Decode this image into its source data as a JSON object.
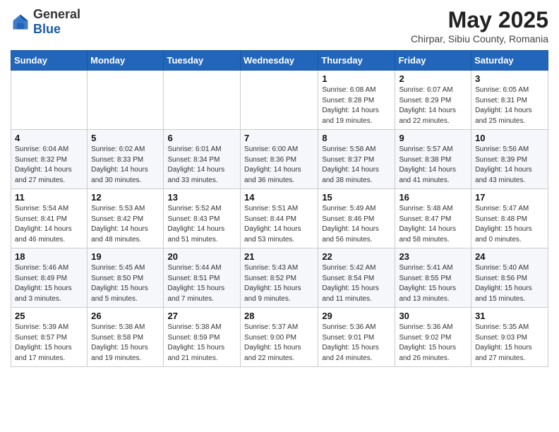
{
  "header": {
    "logo_general": "General",
    "logo_blue": "Blue",
    "month_title": "May 2025",
    "subtitle": "Chirpar, Sibiu County, Romania"
  },
  "weekdays": [
    "Sunday",
    "Monday",
    "Tuesday",
    "Wednesday",
    "Thursday",
    "Friday",
    "Saturday"
  ],
  "weeks": [
    [
      {
        "day": "",
        "info": ""
      },
      {
        "day": "",
        "info": ""
      },
      {
        "day": "",
        "info": ""
      },
      {
        "day": "",
        "info": ""
      },
      {
        "day": "1",
        "info": "Sunrise: 6:08 AM\nSunset: 8:28 PM\nDaylight: 14 hours\nand 19 minutes."
      },
      {
        "day": "2",
        "info": "Sunrise: 6:07 AM\nSunset: 8:29 PM\nDaylight: 14 hours\nand 22 minutes."
      },
      {
        "day": "3",
        "info": "Sunrise: 6:05 AM\nSunset: 8:31 PM\nDaylight: 14 hours\nand 25 minutes."
      }
    ],
    [
      {
        "day": "4",
        "info": "Sunrise: 6:04 AM\nSunset: 8:32 PM\nDaylight: 14 hours\nand 27 minutes."
      },
      {
        "day": "5",
        "info": "Sunrise: 6:02 AM\nSunset: 8:33 PM\nDaylight: 14 hours\nand 30 minutes."
      },
      {
        "day": "6",
        "info": "Sunrise: 6:01 AM\nSunset: 8:34 PM\nDaylight: 14 hours\nand 33 minutes."
      },
      {
        "day": "7",
        "info": "Sunrise: 6:00 AM\nSunset: 8:36 PM\nDaylight: 14 hours\nand 36 minutes."
      },
      {
        "day": "8",
        "info": "Sunrise: 5:58 AM\nSunset: 8:37 PM\nDaylight: 14 hours\nand 38 minutes."
      },
      {
        "day": "9",
        "info": "Sunrise: 5:57 AM\nSunset: 8:38 PM\nDaylight: 14 hours\nand 41 minutes."
      },
      {
        "day": "10",
        "info": "Sunrise: 5:56 AM\nSunset: 8:39 PM\nDaylight: 14 hours\nand 43 minutes."
      }
    ],
    [
      {
        "day": "11",
        "info": "Sunrise: 5:54 AM\nSunset: 8:41 PM\nDaylight: 14 hours\nand 46 minutes."
      },
      {
        "day": "12",
        "info": "Sunrise: 5:53 AM\nSunset: 8:42 PM\nDaylight: 14 hours\nand 48 minutes."
      },
      {
        "day": "13",
        "info": "Sunrise: 5:52 AM\nSunset: 8:43 PM\nDaylight: 14 hours\nand 51 minutes."
      },
      {
        "day": "14",
        "info": "Sunrise: 5:51 AM\nSunset: 8:44 PM\nDaylight: 14 hours\nand 53 minutes."
      },
      {
        "day": "15",
        "info": "Sunrise: 5:49 AM\nSunset: 8:46 PM\nDaylight: 14 hours\nand 56 minutes."
      },
      {
        "day": "16",
        "info": "Sunrise: 5:48 AM\nSunset: 8:47 PM\nDaylight: 14 hours\nand 58 minutes."
      },
      {
        "day": "17",
        "info": "Sunrise: 5:47 AM\nSunset: 8:48 PM\nDaylight: 15 hours\nand 0 minutes."
      }
    ],
    [
      {
        "day": "18",
        "info": "Sunrise: 5:46 AM\nSunset: 8:49 PM\nDaylight: 15 hours\nand 3 minutes."
      },
      {
        "day": "19",
        "info": "Sunrise: 5:45 AM\nSunset: 8:50 PM\nDaylight: 15 hours\nand 5 minutes."
      },
      {
        "day": "20",
        "info": "Sunrise: 5:44 AM\nSunset: 8:51 PM\nDaylight: 15 hours\nand 7 minutes."
      },
      {
        "day": "21",
        "info": "Sunrise: 5:43 AM\nSunset: 8:52 PM\nDaylight: 15 hours\nand 9 minutes."
      },
      {
        "day": "22",
        "info": "Sunrise: 5:42 AM\nSunset: 8:54 PM\nDaylight: 15 hours\nand 11 minutes."
      },
      {
        "day": "23",
        "info": "Sunrise: 5:41 AM\nSunset: 8:55 PM\nDaylight: 15 hours\nand 13 minutes."
      },
      {
        "day": "24",
        "info": "Sunrise: 5:40 AM\nSunset: 8:56 PM\nDaylight: 15 hours\nand 15 minutes."
      }
    ],
    [
      {
        "day": "25",
        "info": "Sunrise: 5:39 AM\nSunset: 8:57 PM\nDaylight: 15 hours\nand 17 minutes."
      },
      {
        "day": "26",
        "info": "Sunrise: 5:38 AM\nSunset: 8:58 PM\nDaylight: 15 hours\nand 19 minutes."
      },
      {
        "day": "27",
        "info": "Sunrise: 5:38 AM\nSunset: 8:59 PM\nDaylight: 15 hours\nand 21 minutes."
      },
      {
        "day": "28",
        "info": "Sunrise: 5:37 AM\nSunset: 9:00 PM\nDaylight: 15 hours\nand 22 minutes."
      },
      {
        "day": "29",
        "info": "Sunrise: 5:36 AM\nSunset: 9:01 PM\nDaylight: 15 hours\nand 24 minutes."
      },
      {
        "day": "30",
        "info": "Sunrise: 5:36 AM\nSunset: 9:02 PM\nDaylight: 15 hours\nand 26 minutes."
      },
      {
        "day": "31",
        "info": "Sunrise: 5:35 AM\nSunset: 9:03 PM\nDaylight: 15 hours\nand 27 minutes."
      }
    ]
  ]
}
